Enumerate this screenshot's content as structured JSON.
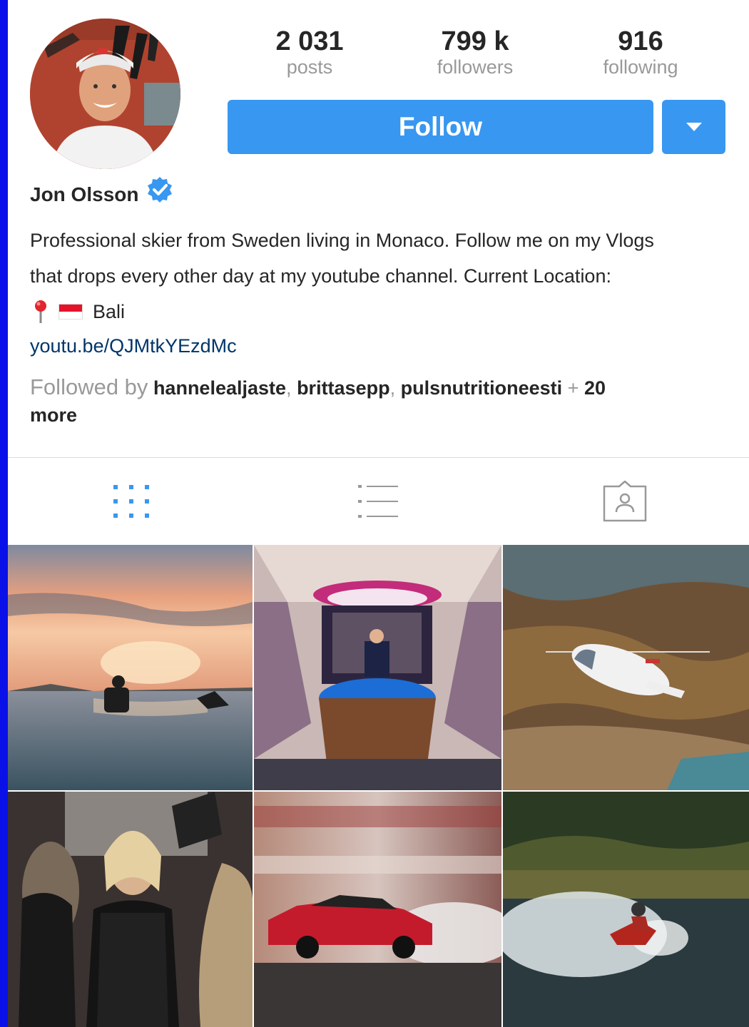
{
  "profile": {
    "name": "Jon Olsson",
    "verified": true,
    "avatar_icon": "profile-photo"
  },
  "stats": {
    "posts": {
      "value": "2 031",
      "label": "posts"
    },
    "followers": {
      "value": "799 k",
      "label": "followers"
    },
    "following": {
      "value": "916",
      "label": "following"
    }
  },
  "actions": {
    "follow_label": "Follow",
    "dropdown_icon": "caret-down-icon"
  },
  "bio": {
    "line1": "Professional skier from Sweden living in Monaco. Follow me on my Vlogs",
    "line2": "that drops every other day at my youtube channel. Current Location:",
    "location": "Bali",
    "link": "youtu.be/QJMtkYEzdMc"
  },
  "followed_by": {
    "prefix": "Followed by",
    "user1": "hannelealjaste",
    "user2": "brittasepp",
    "user3": "pulsnutritioneesti",
    "plus": "+",
    "more_count": "20",
    "more": "more"
  },
  "tabs": [
    {
      "name": "grid-view",
      "icon": "grid-icon",
      "active": true
    },
    {
      "name": "list-view",
      "icon": "list-icon",
      "active": false
    },
    {
      "name": "tagged",
      "icon": "tagged-person-icon",
      "active": false
    }
  ],
  "colors": {
    "accent": "#3897f0",
    "link": "#003569",
    "muted": "#999999",
    "text": "#262626"
  }
}
